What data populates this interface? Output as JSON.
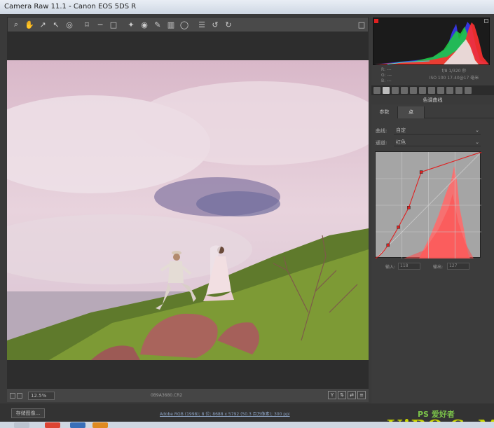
{
  "window": {
    "title": "Camera Raw 11.1 -  Canon EOS 5DS R"
  },
  "toolbar": {
    "tools": [
      "zoom-icon",
      "hand-icon",
      "white-balance-icon",
      "color-sampler-icon",
      "target-adjust-icon",
      "crop-icon",
      "straighten-icon",
      "transform-icon",
      "spot-removal-icon",
      "red-eye-icon",
      "adjustment-brush-icon",
      "graduated-filter-icon",
      "radial-filter-icon",
      "preferences-icon",
      "rotate-left-icon",
      "rotate-right-icon"
    ]
  },
  "status": {
    "zoom": "12.5%",
    "filename": "0B9A3680.CR2",
    "view_buttons": [
      "Y",
      "⇅",
      "⇄",
      "≡"
    ]
  },
  "footer": {
    "save_label": "存储图像...",
    "workflow": "Adobe RGB (1998); 8 位; 8688 x 5792 (50.3 百万像素); 300 ppi"
  },
  "histogram": {
    "readout_r": "R:  ---",
    "readout_g": "G:  ---",
    "readout_b": "B:  ---",
    "exposure": "f/8   1/320 秒",
    "iso_lens": "ISO 100   17-40@17 毫米"
  },
  "panel": {
    "title": "色调曲线",
    "subtab_param": "参数",
    "subtab_point": "点",
    "curve_label": "曲线:",
    "curve_value": "自定",
    "channel_label": "通道:",
    "channel_value": "红色",
    "input_label": "输入:",
    "input_value": "118",
    "output_label": "输出:",
    "output_value": "127"
  },
  "curve_points": [
    [
      0,
      0
    ],
    [
      30,
      32
    ],
    [
      55,
      75
    ],
    [
      80,
      122
    ],
    [
      110,
      207
    ],
    [
      255,
      255
    ]
  ],
  "colors": {
    "curve": "#e02020",
    "histogram_fill": "#ff6060"
  },
  "watermark": {
    "top": "PS 爱好者",
    "main": "UiBQ.CoM"
  }
}
